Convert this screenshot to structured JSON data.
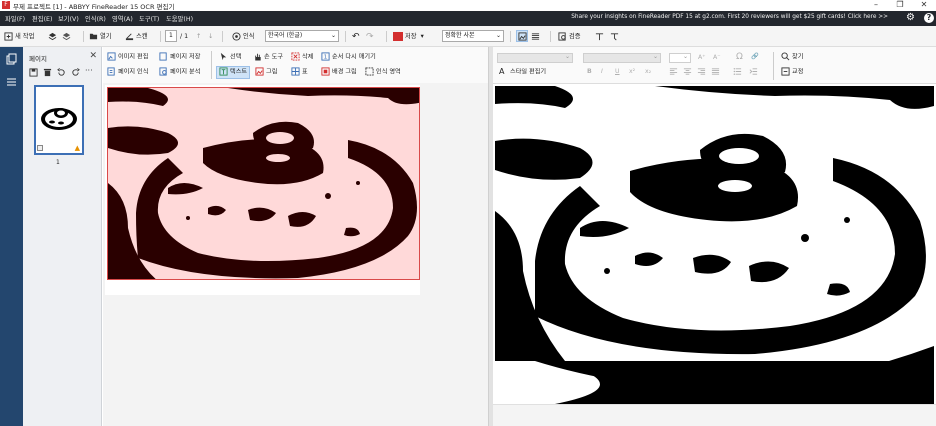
{
  "titlebar": {
    "app_icon_label": "F",
    "title": "무제 프로젝트 [1] - ABBYY FineReader 15 OCR 편집기",
    "minimize": "–",
    "maximize": "❐",
    "close": "✕"
  },
  "menu": {
    "items": [
      "파일(F)",
      "편집(E)",
      "보기(V)",
      "인식(R)",
      "영역(A)",
      "도구(T)",
      "도움말(H)"
    ],
    "promo": "Share your insights on FineReader PDF 15 at g2.com. First 20 reviewers will get $25 gift cards! Click here >>",
    "gear": "⚙",
    "help": "?"
  },
  "toolbar": {
    "new_task": "새 작업",
    "open": "열기",
    "scan": "스캔",
    "page_current": "1",
    "page_total": "/ 1",
    "recognize": "인식",
    "language": "한국어 (한글)",
    "save": "저장",
    "save_format": "정확한 사본",
    "verify": "검증",
    "up": "↑",
    "down": "↓",
    "undo": "↶",
    "redo": "↷"
  },
  "pages_panel": {
    "header": "페이지",
    "close": "✕",
    "page_number": "1",
    "more": "···"
  },
  "image_tools": {
    "edit_image": "이미지 편집",
    "save_page": "페이지 저장",
    "recognize_page": "페이지 인식",
    "analyze_page": "페이지 분석",
    "select": "선택",
    "hand_tool": "손 도구",
    "delete": "삭제",
    "reorder": "순서 다시 매기기",
    "text": "텍스트",
    "picture": "그림",
    "table": "표",
    "background_picture": "배경 그림",
    "recognition_area": "인식 영역"
  },
  "text_tools": {
    "style_editor": "스타일 편집기",
    "find": "찾기",
    "correct": "교정",
    "bold": "B",
    "italic": "I",
    "underline": "U",
    "superscript": "x²",
    "subscript": "x₂",
    "grow": "A⁺",
    "shrink": "A⁻"
  },
  "colors": {
    "menubar": "#23272e",
    "leftstrip": "#23466e",
    "text_block_fill": "#ffd9d9",
    "text_block_border": "#d94a4a",
    "ink_dark": "#2a0000",
    "accent": "#3c6fb5"
  }
}
